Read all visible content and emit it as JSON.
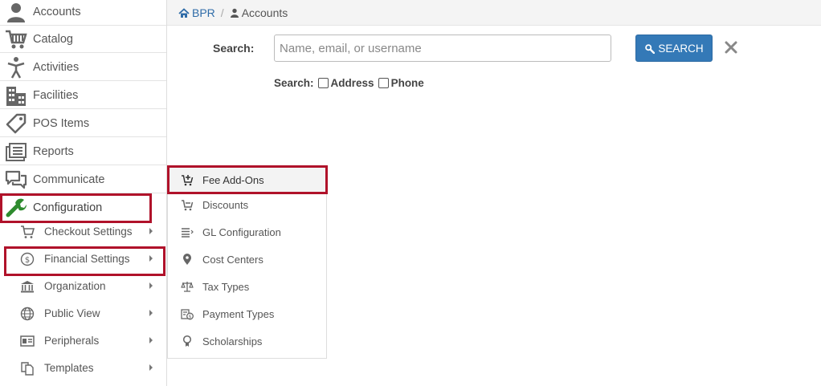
{
  "sidebar": {
    "items": [
      {
        "label": "Accounts",
        "icon": "person-icon"
      },
      {
        "label": "Catalog",
        "icon": "shopping-cart-icon"
      },
      {
        "label": "Activities",
        "icon": "activity-person-icon"
      },
      {
        "label": "Facilities",
        "icon": "building-icon"
      },
      {
        "label": "POS Items",
        "icon": "tag-icon"
      },
      {
        "label": "Reports",
        "icon": "reports-icon"
      },
      {
        "label": "Communicate",
        "icon": "chat-icon"
      },
      {
        "label": "Configuration",
        "icon": "wrench-icon"
      }
    ],
    "sub_items": [
      {
        "label": "Checkout Settings",
        "icon": "cart-icon"
      },
      {
        "label": "Financial Settings",
        "icon": "dollar-circle-icon"
      },
      {
        "label": "Organization",
        "icon": "bank-icon"
      },
      {
        "label": "Public View",
        "icon": "globe-icon"
      },
      {
        "label": "Peripherals",
        "icon": "id-card-icon"
      },
      {
        "label": "Templates",
        "icon": "copy-icon"
      }
    ]
  },
  "breadcrumb": {
    "home": "BPR",
    "separator": "/",
    "current": "Accounts"
  },
  "search": {
    "label": "Search:",
    "placeholder": "Name, email, or username",
    "value": "",
    "button_label": "SEARCH",
    "options_label": "Search:",
    "option_address": "Address",
    "option_phone": "Phone"
  },
  "flyout": {
    "items": [
      {
        "label": "Fee Add-Ons",
        "icon": "cart-plus-icon"
      },
      {
        "label": "Discounts",
        "icon": "cart-minus-icon"
      },
      {
        "label": "GL Configuration",
        "icon": "list-icon"
      },
      {
        "label": "Cost Centers",
        "icon": "map-marker-icon"
      },
      {
        "label": "Tax Types",
        "icon": "scale-icon"
      },
      {
        "label": "Payment Types",
        "icon": "payment-icon"
      },
      {
        "label": "Scholarships",
        "icon": "award-icon"
      }
    ]
  },
  "colors": {
    "accent": "#3479b7",
    "highlight_border": "#b0122a",
    "link": "#2f6ca8",
    "configuration_icon": "#2e8b2e"
  }
}
